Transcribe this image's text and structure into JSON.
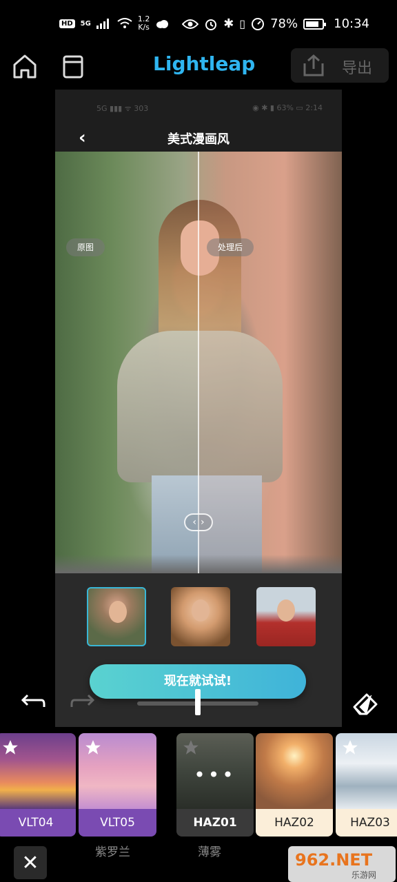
{
  "status_bar": {
    "hd": "HD",
    "network": "5G",
    "speed_value": "1.2",
    "speed_unit": "K/s",
    "battery": "78%",
    "time": "10:34"
  },
  "topbar": {
    "app_title": "Lightleap",
    "export_label": "导出"
  },
  "preview": {
    "inner_status_left": "5G ▮▮▮ ᯤ 303",
    "inner_status_right": "◉ ✱ ▮ 63% ▭ 2:14",
    "title": "美式漫画风",
    "before_label": "原图",
    "after_label": "处理后",
    "try_button": "现在就试试!"
  },
  "filters": {
    "items": [
      {
        "name": "VLT04"
      },
      {
        "name": "VLT05"
      },
      {
        "name": "HAZ01"
      },
      {
        "name": "HAZ02"
      },
      {
        "name": "HAZ03"
      }
    ],
    "category_1": "紫罗兰",
    "category_2": "薄雾"
  },
  "watermark": {
    "brand": "962.NET",
    "sub": "乐游网"
  },
  "colors": {
    "accent": "#2fb5f0",
    "violet": "#7a4bb2",
    "try_gradient_start": "#5ad2d0",
    "try_gradient_end": "#3fb3d9"
  }
}
